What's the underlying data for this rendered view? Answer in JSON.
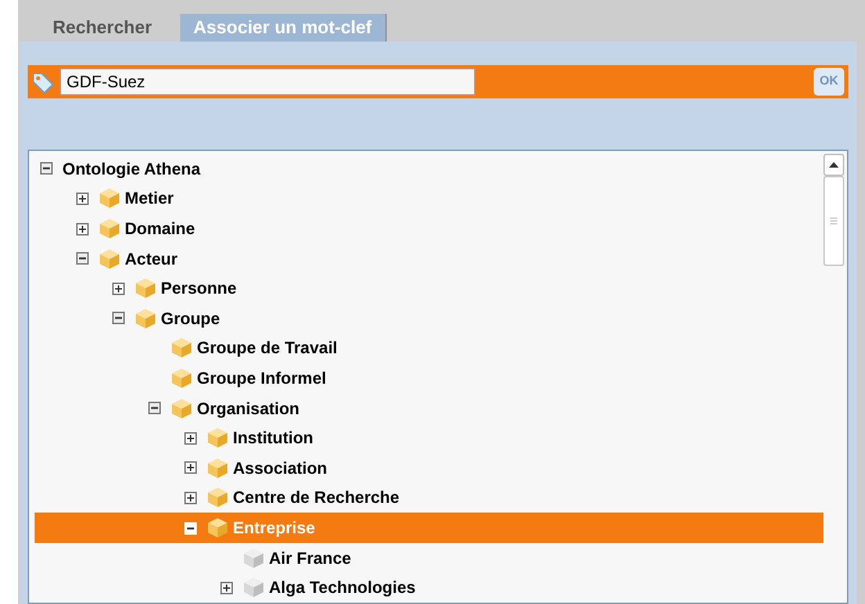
{
  "tabs": [
    {
      "label": "Rechercher",
      "selected": false
    },
    {
      "label": "Associer un mot-clef",
      "selected": true
    }
  ],
  "keyword_bar": {
    "value": "GDF-Suez",
    "button": "OK"
  },
  "tree": [
    {
      "label": "Ontologie Athena",
      "expandable": true,
      "expanded": true,
      "selected": false,
      "children": [
        {
          "label": "Metier",
          "kind": "class",
          "expandable": true,
          "expanded": false,
          "selected": false
        },
        {
          "label": "Domaine",
          "kind": "class",
          "expandable": true,
          "expanded": false,
          "selected": false
        },
        {
          "label": "Acteur",
          "kind": "class",
          "expandable": true,
          "expanded": true,
          "selected": false,
          "children": [
            {
              "label": "Personne",
              "kind": "class",
              "expandable": true,
              "expanded": false,
              "selected": false
            },
            {
              "label": "Groupe",
              "kind": "class",
              "expandable": true,
              "expanded": true,
              "selected": false,
              "children": [
                {
                  "label": "Groupe de Travail",
                  "kind": "class",
                  "expandable": false,
                  "selected": false
                },
                {
                  "label": "Groupe Informel",
                  "kind": "class",
                  "expandable": false,
                  "selected": false
                },
                {
                  "label": "Organisation",
                  "kind": "class",
                  "expandable": true,
                  "expanded": true,
                  "selected": false,
                  "children": [
                    {
                      "label": "Institution",
                      "kind": "class",
                      "expandable": true,
                      "expanded": false,
                      "selected": false
                    },
                    {
                      "label": "Association",
                      "kind": "class",
                      "expandable": true,
                      "expanded": false,
                      "selected": false
                    },
                    {
                      "label": "Centre de Recherche",
                      "kind": "class",
                      "expandable": true,
                      "expanded": false,
                      "selected": false
                    },
                    {
                      "label": "Entreprise",
                      "kind": "class",
                      "expandable": true,
                      "expanded": true,
                      "selected": true,
                      "children": [
                        {
                          "label": "Air France",
                          "kind": "instance",
                          "expandable": false,
                          "selected": false
                        },
                        {
                          "label": "Alga Technologies",
                          "kind": "instance",
                          "expandable": true,
                          "expanded": false,
                          "selected": false
                        }
                      ]
                    }
                  ]
                }
              ]
            }
          ]
        }
      ]
    }
  ]
}
